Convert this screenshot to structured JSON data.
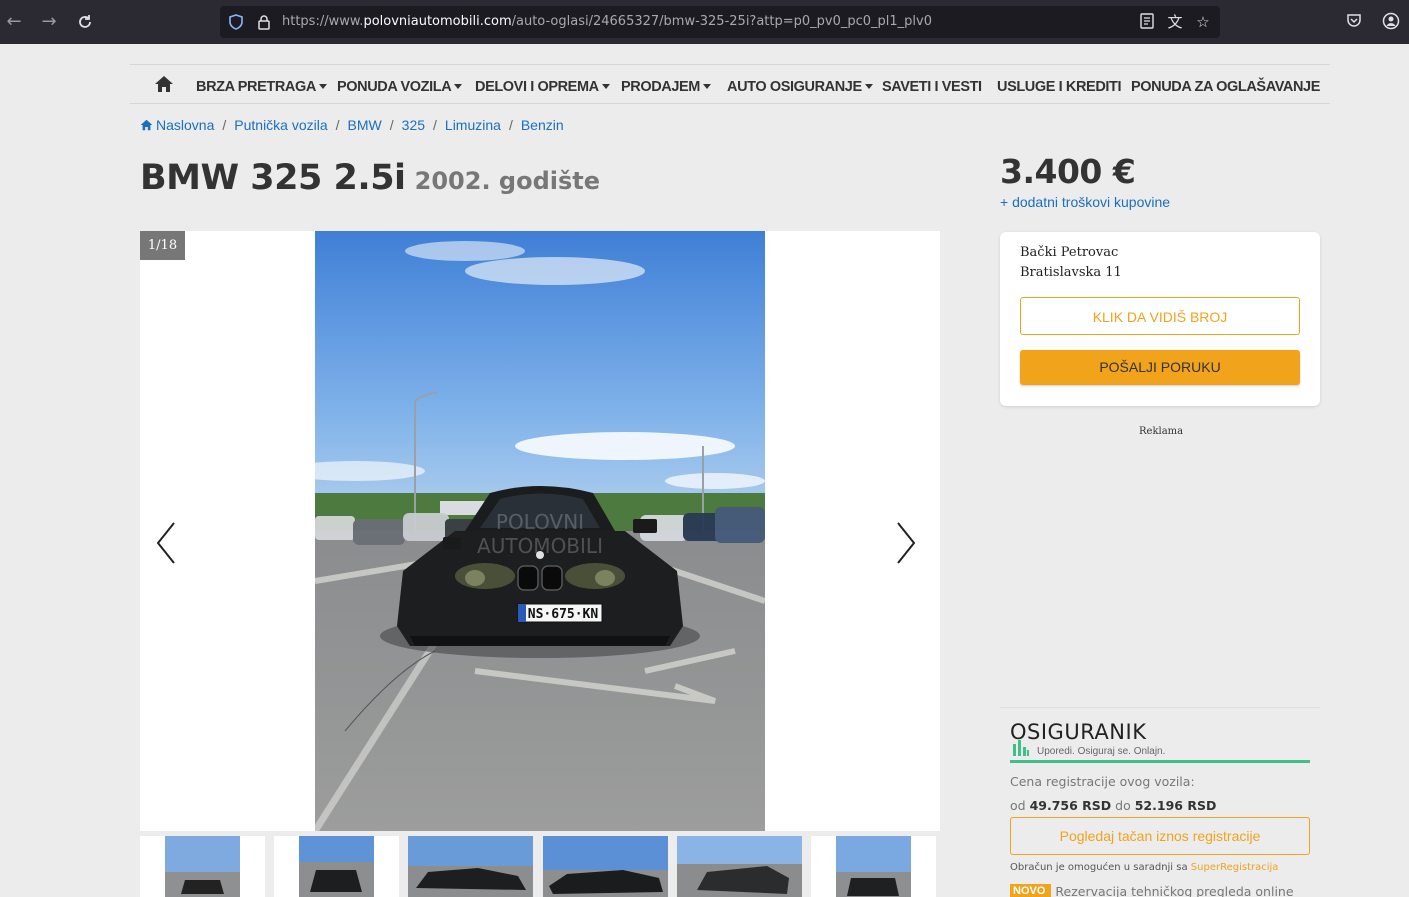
{
  "browser": {
    "url_prefix": "https://www.",
    "url_domain": "polovniautomobili.com",
    "url_path": "/auto-oglasi/24665327/bmw-325-25i?attp=p0_pv0_pc0_pl1_plv0"
  },
  "nav": {
    "items": [
      {
        "label": "BRZA PRETRAGA",
        "dropdown": true
      },
      {
        "label": "PONUDA VOZILA",
        "dropdown": true
      },
      {
        "label": "DELOVI I OPREMA",
        "dropdown": true
      },
      {
        "label": "PRODAJEM",
        "dropdown": true
      },
      {
        "label": "AUTO OSIGURANJE",
        "dropdown": true
      },
      {
        "label": "SAVETI I VESTI",
        "dropdown": false
      },
      {
        "label": "USLUGE I KREDITI",
        "dropdown": false
      },
      {
        "label": "PONUDA ZA OGLAŠAVANJE",
        "dropdown": false
      }
    ]
  },
  "breadcrumb": [
    "Naslovna",
    "Putnička vozila",
    "BMW",
    "325",
    "Limuzina",
    "Benzin"
  ],
  "listing": {
    "title": "BMW 325 2.5i",
    "year": "2002. godište",
    "price": "3.400 €",
    "extra_costs": "+ dodatni troškovi kupovine",
    "gallery_counter": "1/18",
    "watermark_line1": "POLOVNI",
    "watermark_line2": "AUTOMOBILI",
    "plate": "NS·675·KN"
  },
  "seller": {
    "city": "Bački Petrovac",
    "address": "Bratislavska 11",
    "show_number": "KLIK DA VIDIŠ BROJ",
    "send_message": "POŠALJI PORUKU"
  },
  "ad_label": "Reklama",
  "osiguranik": {
    "logo": "OSIGURANIK",
    "tagline": "Uporedi. Osiguraj se. Onlajn.",
    "reg_title": "Cena registracije ovog vozila:",
    "from_word": "od",
    "from_value": "49.756 RSD",
    "to_word": "do",
    "to_value": "52.196 RSD",
    "button": "Pogledaj tačan iznos registracije",
    "note": "Obračun je omogućen u saradnji sa",
    "note_link": "SuperRegistracija",
    "novo_badge": "NOVO",
    "novo_text": "Rezervacija tehničkog pregleda online"
  },
  "colors": {
    "accent": "#f1a31b",
    "link": "#1a6fbf",
    "osig_green": "#3fbf8a"
  }
}
